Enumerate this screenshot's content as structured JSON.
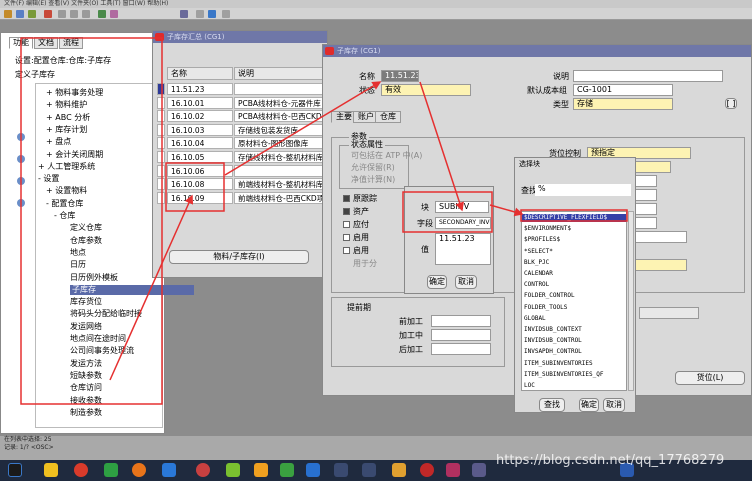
{
  "menubar": {
    "text": "文件(F)  编辑(E)  查看(V)  文件夹(O)  工具(T)  窗口(W)  帮助(H)"
  },
  "nav": {
    "tabs": [
      "功能",
      "文档",
      "流程"
    ],
    "path": "设置:配置仓库:仓库:子库存",
    "title": "定义子库存",
    "tree": [
      {
        "t": "+ 物料事务处理"
      },
      {
        "t": "+ 物料维护"
      },
      {
        "t": "+ ABC 分析"
      },
      {
        "t": "+ 库存计划"
      },
      {
        "t": "+ 盘点"
      },
      {
        "t": "+ 会计关闭周期"
      },
      {
        "t": "+ 人工管理系统"
      },
      {
        "t": "- 设置"
      },
      {
        "t": "+ 设置物料"
      },
      {
        "t": "- 配置仓库"
      },
      {
        "t": "- 仓库"
      },
      {
        "t": "定义仓库"
      },
      {
        "t": "仓库参数"
      },
      {
        "t": "地点"
      },
      {
        "t": "日历"
      },
      {
        "t": "日历例外模板"
      },
      {
        "t": "子库存"
      },
      {
        "t": "库存货位"
      },
      {
        "t": "将码头分配给临时接"
      },
      {
        "t": "发运网络"
      },
      {
        "t": "地点间在途时间"
      },
      {
        "t": "公司间事务处理流"
      },
      {
        "t": "发运方法"
      },
      {
        "t": "短缺参数"
      },
      {
        "t": "仓库访问"
      },
      {
        "t": "接收参数"
      },
      {
        "t": "制造参数"
      }
    ]
  },
  "w1": {
    "title": "子库存汇总 (CG1)",
    "col_name": "名称",
    "col_desc": "说明",
    "rows": [
      {
        "name": "11.51.23",
        "desc": ""
      },
      {
        "name": "16.10.01",
        "desc": "PCBA线材料仓-元器件库"
      },
      {
        "name": "16.10.02",
        "desc": "PCBA线材料仓-巴西CKD"
      },
      {
        "name": "16.10.03",
        "desc": "存储线包装发货库"
      },
      {
        "name": "16.10.04",
        "desc": "原材料仓-图形图像库"
      },
      {
        "name": "16.10.05",
        "desc": "存储线材料仓-整机材料库"
      },
      {
        "name": "16.10.06",
        "desc": ""
      },
      {
        "name": "16.10.08",
        "desc": "前端线材料仓-整机材料库"
      },
      {
        "name": "16.10.09",
        "desc": "前端线材料仓-巴西CKD项"
      }
    ],
    "button": "物料/子库存(I)"
  },
  "w2": {
    "title": "子库存 (CG1)",
    "name_label": "名称",
    "name_value": "11.51.23",
    "status_label": "状态",
    "status_value": "有效",
    "desc_label": "说明",
    "cost_label": "默认成本组",
    "cost_value": "CG-1001",
    "type_label": "类型",
    "type_value": "存储",
    "tabs": [
      "主要",
      "账户",
      "仓库"
    ],
    "params_label": "参数",
    "status_attr_label": "状态属性",
    "status_attrs": [
      "可包括在 ATP 中(A)",
      "允许保留(R)",
      "净值计算(N)"
    ],
    "checks": [
      "原跟踪",
      "资产",
      "应付",
      "启用",
      "启用",
      "用于分"
    ],
    "locator_label": "货位控制",
    "locator_value": "预指定",
    "lead_label": "提前期",
    "pre_label": "前加工",
    "proc_label": "加工中",
    "post_label": "后加工",
    "locator_button": "货位(L)",
    "bracket_label": "[ ]"
  },
  "w3": {
    "title": "",
    "block_label": "块",
    "block_value": "SUBINV",
    "field_label": "字段",
    "field_value": "SECONDARY_INVENTORY_NAME",
    "value_label": "值",
    "value_value": "11.51.23",
    "ok": "确定",
    "cancel": "取消"
  },
  "w4": {
    "title": "选择块",
    "find_label": "查找",
    "find_value": "%",
    "items": [
      "$DESCRIPTIVE_FLEXFIELD$",
      "$ENVIRONMENT$",
      "$PROFILES$",
      "*SELECT*",
      "BLK_PJC",
      "CALENDAR",
      "CONTROL",
      "FOLDER_CONTROL",
      "FOLDER_TOOLS",
      "GLOBAL",
      "INVIDSUB_CONTEXT",
      "INVIDSUB_CONTROL",
      "INVSAPDH_CONTROL",
      "ITEM_SUBINVENTORIES",
      "ITEM_SUBINVENTORIES_QF",
      "LOC"
    ],
    "find_button": "查找",
    "ok_button": "确定",
    "cancel_button": "取消"
  },
  "status": {
    "line1": "在列表中选择: 25",
    "line2": "记录: 1/?     <OSC>"
  },
  "watermark": "https://blog.csdn.net/qq_17768279",
  "colors": {
    "accent": "#6f77a8",
    "annotation": "#e53030",
    "selection": "#3540a8"
  }
}
